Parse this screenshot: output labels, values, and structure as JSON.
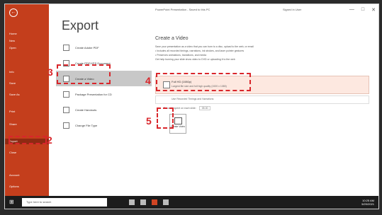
{
  "window": {
    "title": "PowerPoint Presentation - Saved to this PC",
    "user": "Signed in User",
    "buttons": [
      "—",
      "□",
      "✕"
    ]
  },
  "sidebar": {
    "back": "←",
    "items": [
      "Home",
      "New",
      "Open",
      "Info",
      "Save",
      "Save As",
      "Print",
      "Share",
      "Export",
      "Close",
      "Account",
      "Options"
    ],
    "selected_index": 8
  },
  "export": {
    "heading": "Export",
    "items": [
      "Create Adobe PDF",
      "Create PDF/XPS Document",
      "Create a Video",
      "Package Presentation for CD",
      "Create Handouts",
      "Change File Type"
    ],
    "selected_index": 2
  },
  "detail": {
    "title": "Create a Video",
    "lines": [
      "Save your presentation as a video that you can burn to a disc, upload to the web, or email",
      "• Includes all recorded timings, narrations, ink strokes, and laser pointer gestures",
      "• Preserves animations, transitions, and media",
      "Get help burning your slide show video to DVD or uploading it to the web"
    ],
    "quality_title": "Full HD (1080p)",
    "quality_desc": "Largest file size and full high quality (1920 x 1080)",
    "timings": "Use Recorded Timings and Narrations",
    "seconds_label": "Seconds spent on each slide:",
    "seconds_value": "05.00",
    "create_button": "Create Video"
  },
  "annotations": [
    "2",
    "3",
    "4",
    "5"
  ],
  "taskbar": {
    "start": "⊞",
    "search": "Type here to search",
    "time": "10:25 AM",
    "date": "5/20/2021"
  },
  "colors": {
    "accent": "#c43e1c",
    "highlight": "#d9262b"
  }
}
